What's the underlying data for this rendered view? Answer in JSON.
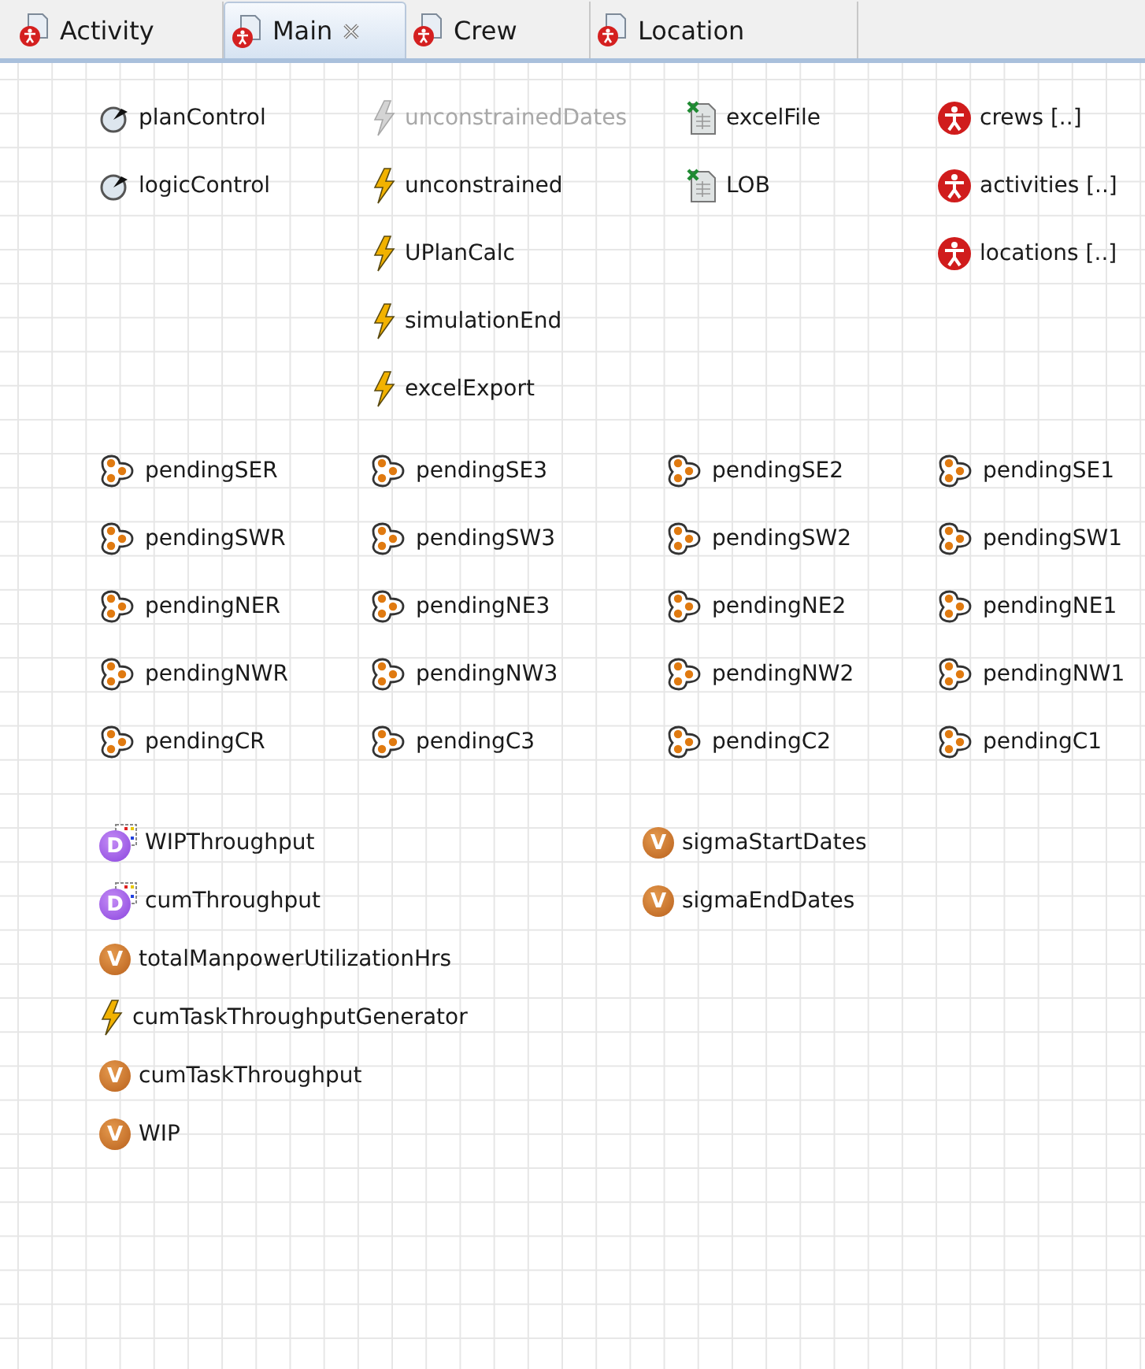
{
  "tabs": [
    {
      "label": "Activity",
      "selected": false,
      "closable": false
    },
    {
      "label": "Main",
      "selected": true,
      "closable": true
    },
    {
      "label": "Crew",
      "selected": false,
      "closable": false
    },
    {
      "label": "Location",
      "selected": false,
      "closable": false
    }
  ],
  "sections": [
    {
      "columns": [
        [
          {
            "kind": "control",
            "label": "planControl"
          },
          {
            "kind": "control",
            "label": "logicControl"
          }
        ],
        [
          {
            "kind": "event",
            "label": "unconstrainedDates",
            "disabled": true
          },
          {
            "kind": "event",
            "label": "unconstrained",
            "disabled": false
          },
          {
            "kind": "event",
            "label": "UPlanCalc",
            "disabled": false
          },
          {
            "kind": "event",
            "label": "simulationEnd",
            "disabled": false
          },
          {
            "kind": "event",
            "label": "excelExport",
            "disabled": false
          }
        ],
        [
          {
            "kind": "excel",
            "label": "excelFile"
          },
          {
            "kind": "excel",
            "label": "LOB"
          }
        ],
        [
          {
            "kind": "population",
            "label": "crews [..]"
          },
          {
            "kind": "population",
            "label": "activities [..]"
          },
          {
            "kind": "population",
            "label": "locations [..]"
          }
        ]
      ]
    },
    {
      "columns": [
        [
          {
            "kind": "collection",
            "label": "pendingSER"
          },
          {
            "kind": "collection",
            "label": "pendingSWR"
          },
          {
            "kind": "collection",
            "label": "pendingNER"
          },
          {
            "kind": "collection",
            "label": "pendingNWR"
          },
          {
            "kind": "collection",
            "label": "pendingCR"
          }
        ],
        [
          {
            "kind": "collection",
            "label": "pendingSE3"
          },
          {
            "kind": "collection",
            "label": "pendingSW3"
          },
          {
            "kind": "collection",
            "label": "pendingNE3"
          },
          {
            "kind": "collection",
            "label": "pendingNW3"
          },
          {
            "kind": "collection",
            "label": "pendingC3"
          }
        ],
        [
          {
            "kind": "collection",
            "label": "pendingSE2"
          },
          {
            "kind": "collection",
            "label": "pendingSW2"
          },
          {
            "kind": "collection",
            "label": "pendingNE2"
          },
          {
            "kind": "collection",
            "label": "pendingNW2"
          },
          {
            "kind": "collection",
            "label": "pendingC2"
          }
        ],
        [
          {
            "kind": "collection",
            "label": "pendingSE1"
          },
          {
            "kind": "collection",
            "label": "pendingSW1"
          },
          {
            "kind": "collection",
            "label": "pendingNE1"
          },
          {
            "kind": "collection",
            "label": "pendingNW1"
          },
          {
            "kind": "collection",
            "label": "pendingC1"
          }
        ]
      ]
    },
    {
      "columns": [
        [
          {
            "kind": "dataset",
            "badge": "D",
            "label": "WIPThroughput"
          },
          {
            "kind": "dataset",
            "badge": "D",
            "label": "cumThroughput"
          },
          {
            "kind": "variable",
            "badge": "V",
            "label": "totalManpowerUtilizationHrs"
          },
          {
            "kind": "event",
            "label": "cumTaskThroughputGenerator",
            "disabled": false
          },
          {
            "kind": "variable",
            "badge": "V",
            "label": "cumTaskThroughput"
          },
          {
            "kind": "variable",
            "badge": "V",
            "label": "WIP"
          }
        ],
        [
          {
            "kind": "variable",
            "badge": "V",
            "label": "sigmaStartDates"
          },
          {
            "kind": "variable",
            "badge": "V",
            "label": "sigmaEndDates"
          }
        ]
      ]
    }
  ]
}
